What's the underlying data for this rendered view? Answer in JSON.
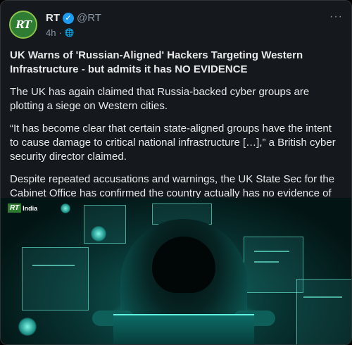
{
  "post": {
    "author": {
      "name": "RT",
      "handle": "@RT",
      "avatar_text": "RT",
      "verified_icon": "verified-badge-icon"
    },
    "timestamp": "4h",
    "separator": "·",
    "visibility_icon": "globe-icon",
    "more_label": "···",
    "headline": "UK Warns of 'Russian-Aligned' Hackers Targeting Western Infrastructure - but admits it has NO EVIDENCE",
    "paragraphs": [
      "The UK has again claimed that Russia-backed cyber groups are plotting a siege on Western cities.",
      "“It has become clear that certain state-aligned groups have the intent to cause damage to critical national infrastructure […],” a British cyber security director claimed.",
      "Despite repeated accusations and warnings, the UK State Sec for the Cabinet Office has confirmed the country actually has no evidence of any attacks."
    ],
    "media": {
      "badge_logo": "RT",
      "badge_text": "India"
    }
  },
  "colors": {
    "background": "#15181c",
    "text": "#e7e9ea",
    "muted": "#8b98a5",
    "verified": "#1d9bf0",
    "rt_green": "#2e7d32"
  }
}
